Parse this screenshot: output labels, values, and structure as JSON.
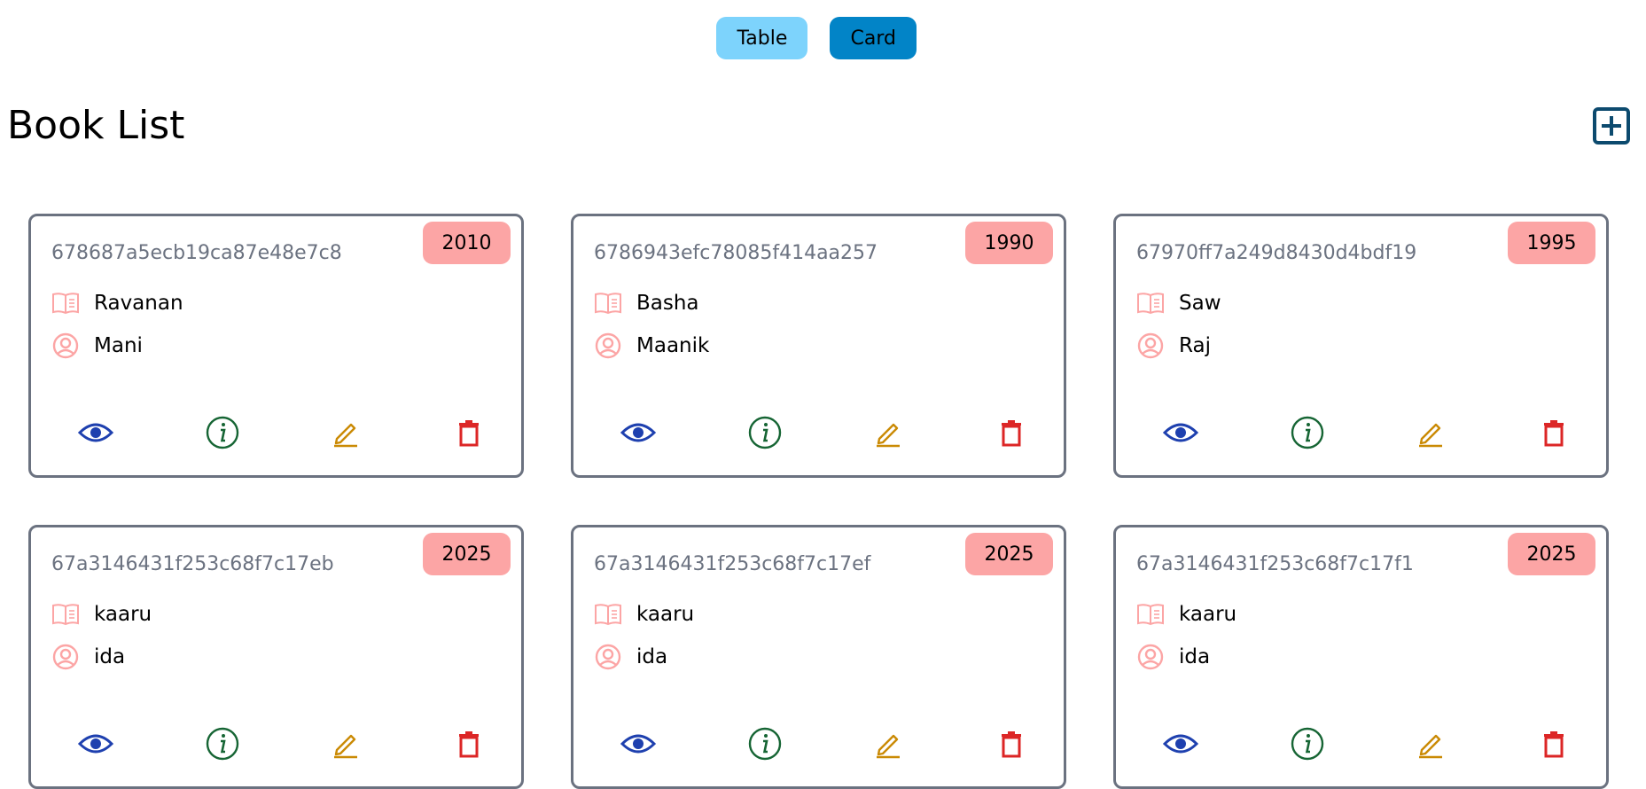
{
  "view_toggle": {
    "table_label": "Table",
    "card_label": "Card"
  },
  "page": {
    "title": "Book List"
  },
  "colors": {
    "badge": "#fca5a5",
    "icon_pink": "#fca5a5",
    "view": "#1e40af",
    "info": "#166534",
    "edit": "#ca8a04",
    "delete": "#dc2626",
    "add": "#0c4a6e"
  },
  "icons": {
    "add": "plus-square-icon",
    "title": "book-open-icon",
    "author": "user-circle-icon",
    "view": "eye-icon",
    "info": "info-circle-icon",
    "edit": "pencil-icon",
    "delete": "trash-icon"
  },
  "books": [
    {
      "id": "678687a5ecb19ca87e48e7c8",
      "title": "Ravanan",
      "author": "Mani",
      "year": "2010"
    },
    {
      "id": "6786943efc78085f414aa257",
      "title": "Basha",
      "author": "Maanik",
      "year": "1990"
    },
    {
      "id": "67970ff7a249d8430d4bdf19",
      "title": "Saw",
      "author": "Raj",
      "year": "1995"
    },
    {
      "id": "67a3146431f253c68f7c17eb",
      "title": "kaaru",
      "author": "ida",
      "year": "2025"
    },
    {
      "id": "67a3146431f253c68f7c17ef",
      "title": "kaaru",
      "author": "ida",
      "year": "2025"
    },
    {
      "id": "67a3146431f253c68f7c17f1",
      "title": "kaaru",
      "author": "ida",
      "year": "2025"
    }
  ]
}
